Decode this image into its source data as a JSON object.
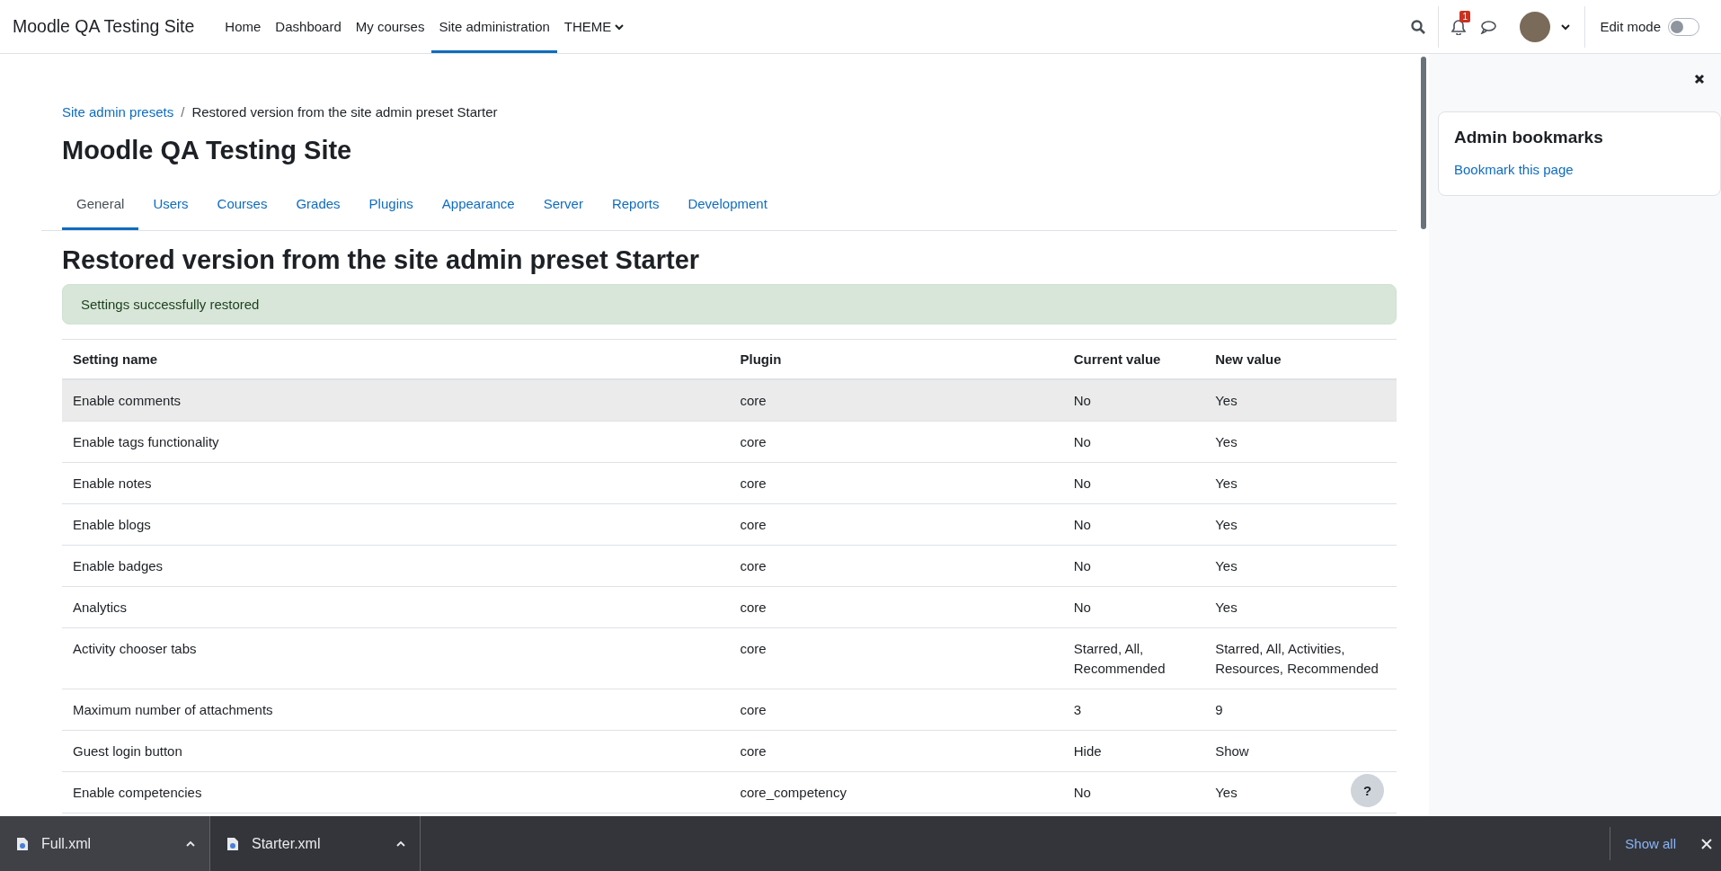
{
  "navbar": {
    "site_name": "Moodle QA Testing Site",
    "items": [
      {
        "label": "Home",
        "selected": false,
        "has_menu": false
      },
      {
        "label": "Dashboard",
        "selected": false,
        "has_menu": false
      },
      {
        "label": "My courses",
        "selected": false,
        "has_menu": false
      },
      {
        "label": "Site administration",
        "selected": true,
        "has_menu": false
      },
      {
        "label": "THEME",
        "selected": false,
        "has_menu": true
      }
    ],
    "notification_count": "1",
    "edit_mode": {
      "label": "Edit mode",
      "on": false
    }
  },
  "breadcrumb_separator": "/",
  "breadcrumb": [
    {
      "label": "Site admin presets",
      "link": true
    },
    {
      "label": "Restored version from the site admin preset Starter",
      "link": false
    }
  ],
  "page_title": "Moodle QA Testing Site",
  "tabs": [
    {
      "label": "General",
      "selected": true
    },
    {
      "label": "Users",
      "selected": false
    },
    {
      "label": "Courses",
      "selected": false
    },
    {
      "label": "Grades",
      "selected": false
    },
    {
      "label": "Plugins",
      "selected": false
    },
    {
      "label": "Appearance",
      "selected": false
    },
    {
      "label": "Server",
      "selected": false
    },
    {
      "label": "Reports",
      "selected": false
    },
    {
      "label": "Development",
      "selected": false
    }
  ],
  "heading": "Restored version from the site admin preset Starter",
  "alert": "Settings successfully restored",
  "table": {
    "columns": [
      "Setting name",
      "Plugin",
      "Current value",
      "New value"
    ],
    "rows": [
      {
        "cells": [
          "Enable comments",
          "core",
          "No",
          "Yes"
        ],
        "highlighted": true
      },
      {
        "cells": [
          "Enable tags functionality",
          "core",
          "No",
          "Yes"
        ],
        "highlighted": false
      },
      {
        "cells": [
          "Enable notes",
          "core",
          "No",
          "Yes"
        ],
        "highlighted": false
      },
      {
        "cells": [
          "Enable blogs",
          "core",
          "No",
          "Yes"
        ],
        "highlighted": false
      },
      {
        "cells": [
          "Enable badges",
          "core",
          "No",
          "Yes"
        ],
        "highlighted": false
      },
      {
        "cells": [
          "Analytics",
          "core",
          "No",
          "Yes"
        ],
        "highlighted": false
      },
      {
        "cells": [
          "Activity chooser tabs",
          "core",
          "Starred, All, Recommended",
          "Starred, All, Activities, Resources, Recommended"
        ],
        "highlighted": false
      },
      {
        "cells": [
          "Maximum number of attachments",
          "core",
          "3",
          "9"
        ],
        "highlighted": false
      },
      {
        "cells": [
          "Guest login button",
          "core",
          "Hide",
          "Show"
        ],
        "highlighted": false
      },
      {
        "cells": [
          "Enable competencies",
          "core_competency",
          "No",
          "Yes"
        ],
        "highlighted": false
      }
    ]
  },
  "help_button": "?",
  "drawer": {
    "block_title": "Admin bookmarks",
    "link": "Bookmark this page"
  },
  "downloads": {
    "items": [
      "Full.xml",
      "Starter.xml"
    ],
    "show_all": "Show all"
  }
}
